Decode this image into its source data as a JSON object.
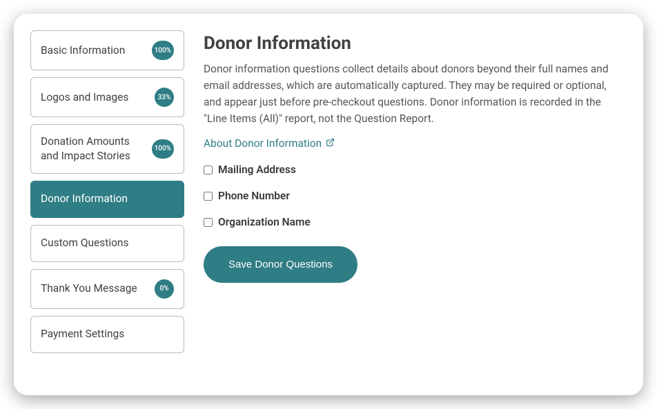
{
  "sidebar": {
    "items": [
      {
        "label": "Basic Information",
        "badge": "100%",
        "active": false
      },
      {
        "label": "Logos and Images",
        "badge": "33%",
        "active": false
      },
      {
        "label": "Donation Amounts and Impact Stories",
        "badge": "100%",
        "active": false
      },
      {
        "label": "Donor Information",
        "badge": null,
        "active": true
      },
      {
        "label": "Custom Questions",
        "badge": null,
        "active": false
      },
      {
        "label": "Thank You Message",
        "badge": "0%",
        "active": false
      },
      {
        "label": "Payment Settings",
        "badge": null,
        "active": false
      }
    ]
  },
  "main": {
    "title": "Donor Information",
    "description": "Donor information questions collect details about donors beyond their full names and email addresses, which are automatically captured. They may be required or optional, and appear just before pre-checkout questions. Donor information is recorded in the \"Line Items (All)\" report, not the Question Report.",
    "help_link_text": "About Donor Information",
    "checkboxes": [
      {
        "label": "Mailing Address",
        "checked": false
      },
      {
        "label": "Phone Number",
        "checked": false
      },
      {
        "label": "Organization Name",
        "checked": false
      }
    ],
    "save_button": "Save Donor Questions"
  }
}
